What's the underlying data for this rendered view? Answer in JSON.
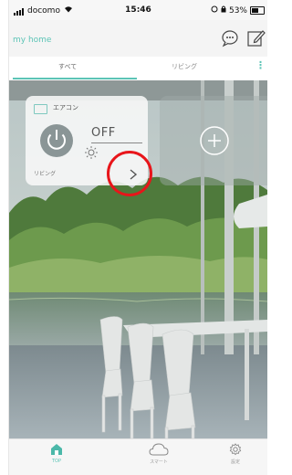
{
  "status_bar": {
    "carrier": "docomo",
    "time": "15:46",
    "battery": "53%"
  },
  "header": {
    "home_title": "my home"
  },
  "tabs": [
    {
      "label": "すべて",
      "active": true
    },
    {
      "label": "リビング",
      "active": false
    }
  ],
  "device_card": {
    "title": "エアコン",
    "state": "OFF",
    "room": "リビング"
  },
  "bottom_nav": [
    {
      "label": "TOP",
      "icon": "home-icon",
      "active": true
    },
    {
      "label": "スマート",
      "icon": "cloud-icon",
      "active": false
    },
    {
      "label": "設定",
      "icon": "gear-icon",
      "active": false
    }
  ],
  "colors": {
    "accent": "#5cc4b6",
    "highlight": "#e8151a"
  }
}
